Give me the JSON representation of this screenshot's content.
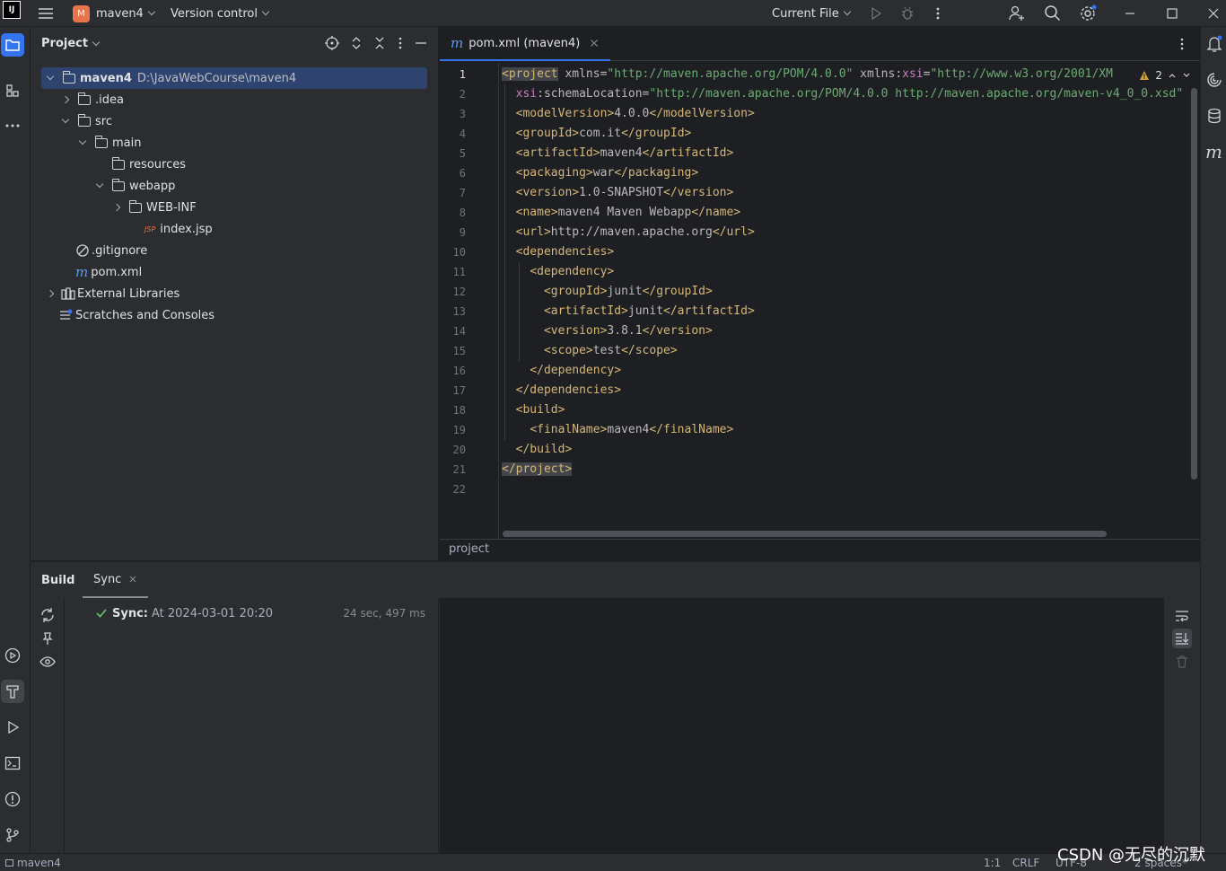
{
  "titlebar": {
    "logo": "IJ",
    "project_badge": "M",
    "project_name": "maven4",
    "vcs_label": "Version control",
    "run_config": "Current File"
  },
  "project_panel": {
    "title": "Project",
    "tree": [
      {
        "label": "maven4",
        "hint": "D:\\JavaWebCourse\\maven4",
        "icon": "module-folder-icon",
        "expanded": true,
        "selected": true
      },
      {
        "label": ".idea",
        "icon": "folder-icon",
        "expanded": false
      },
      {
        "label": "src",
        "icon": "folder-icon",
        "expanded": true
      },
      {
        "label": "main",
        "icon": "folder-icon",
        "expanded": true
      },
      {
        "label": "resources",
        "icon": "resources-folder-icon"
      },
      {
        "label": "webapp",
        "icon": "folder-icon",
        "expanded": true
      },
      {
        "label": "WEB-INF",
        "icon": "folder-icon",
        "expanded": false
      },
      {
        "label": "index.jsp",
        "icon": "jsp-file-icon",
        "badge": "JSP"
      },
      {
        "label": ".gitignore",
        "icon": "ignore-file-icon"
      },
      {
        "label": "pom.xml",
        "icon": "maven-file-icon",
        "badge": "m"
      },
      {
        "label": "External Libraries",
        "icon": "libraries-icon",
        "expanded": false
      },
      {
        "label": "Scratches and Consoles",
        "icon": "scratches-icon"
      }
    ]
  },
  "editor": {
    "tab_label": "pom.xml (maven4)",
    "tab_icon": "m",
    "warning_count": "2",
    "breadcrumb": "project",
    "lines": [
      [
        [
          "t",
          "<project"
        ],
        [
          "a",
          " xmlns="
        ],
        [
          "s",
          "\"http://maven.apache.org/POM/4.0.0\""
        ],
        [
          "a",
          " xmlns:"
        ],
        [
          "ns",
          "xsi"
        ],
        [
          "a",
          "="
        ],
        [
          "s",
          "\"http://www.w3.org/2001/XM"
        ]
      ],
      [
        [
          "a",
          "  "
        ],
        [
          "ns",
          "xsi"
        ],
        [
          "a",
          ":schemaLocation="
        ],
        [
          "s",
          "\"http://maven.apache.org/POM/4.0.0 http://maven.apache.org/maven-v4_0_0.xsd\""
        ]
      ],
      [
        [
          "a",
          "  "
        ],
        [
          "t",
          "<modelVersion>"
        ],
        [
          "a",
          "4.0.0"
        ],
        [
          "t",
          "</modelVersion>"
        ]
      ],
      [
        [
          "a",
          "  "
        ],
        [
          "t",
          "<groupId>"
        ],
        [
          "a",
          "com.it"
        ],
        [
          "t",
          "</groupId>"
        ]
      ],
      [
        [
          "a",
          "  "
        ],
        [
          "t",
          "<artifactId>"
        ],
        [
          "a",
          "maven4"
        ],
        [
          "t",
          "</artifactId>"
        ]
      ],
      [
        [
          "a",
          "  "
        ],
        [
          "t",
          "<packaging>"
        ],
        [
          "a",
          "war"
        ],
        [
          "t",
          "</packaging>"
        ]
      ],
      [
        [
          "a",
          "  "
        ],
        [
          "t",
          "<version>"
        ],
        [
          "a",
          "1.0-SNAPSHOT"
        ],
        [
          "t",
          "</version>"
        ]
      ],
      [
        [
          "a",
          "  "
        ],
        [
          "t",
          "<name>"
        ],
        [
          "a",
          "maven4 Maven Webapp"
        ],
        [
          "t",
          "</name>"
        ]
      ],
      [
        [
          "a",
          "  "
        ],
        [
          "t",
          "<url>"
        ],
        [
          "a",
          "http://maven.apache.org"
        ],
        [
          "t",
          "</url>"
        ]
      ],
      [
        [
          "a",
          "  "
        ],
        [
          "t",
          "<dependencies>"
        ]
      ],
      [
        [
          "a",
          "    "
        ],
        [
          "t",
          "<dependency>"
        ]
      ],
      [
        [
          "a",
          "      "
        ],
        [
          "t",
          "<groupId>"
        ],
        [
          "a",
          "junit"
        ],
        [
          "t",
          "</groupId>"
        ]
      ],
      [
        [
          "a",
          "      "
        ],
        [
          "t",
          "<artifactId>"
        ],
        [
          "a",
          "junit"
        ],
        [
          "t",
          "</artifactId>"
        ]
      ],
      [
        [
          "a",
          "      "
        ],
        [
          "t",
          "<version>"
        ],
        [
          "a",
          "3.8.1"
        ],
        [
          "t",
          "</version>"
        ]
      ],
      [
        [
          "a",
          "      "
        ],
        [
          "t",
          "<scope>"
        ],
        [
          "a",
          "test"
        ],
        [
          "t",
          "</scope>"
        ]
      ],
      [
        [
          "a",
          "    "
        ],
        [
          "t",
          "</dependency>"
        ]
      ],
      [
        [
          "a",
          "  "
        ],
        [
          "t",
          "</dependencies>"
        ]
      ],
      [
        [
          "a",
          "  "
        ],
        [
          "t",
          "<build>"
        ]
      ],
      [
        [
          "a",
          "    "
        ],
        [
          "t",
          "<finalName>"
        ],
        [
          "a",
          "maven4"
        ],
        [
          "t",
          "</finalName>"
        ]
      ],
      [
        [
          "a",
          "  "
        ],
        [
          "t",
          "</build>"
        ]
      ],
      [
        [
          "t",
          "</project>"
        ]
      ],
      []
    ],
    "line_numbers": [
      "1",
      "2",
      "3",
      "4",
      "5",
      "6",
      "7",
      "8",
      "9",
      "10",
      "11",
      "12",
      "13",
      "14",
      "15",
      "16",
      "17",
      "18",
      "19",
      "20",
      "21",
      "22"
    ]
  },
  "build_panel": {
    "tab_build": "Build",
    "tab_sync": "Sync",
    "sync_label": "Sync:",
    "sync_time": "At 2024-03-01 20:20",
    "sync_duration": "24 sec, 497 ms"
  },
  "statusbar": {
    "project": "maven4",
    "position": "1:1",
    "line_sep": "CRLF",
    "encoding": "UTF-8",
    "indent": "2 spaces*"
  },
  "watermark": "CSDN @无尽的沉默",
  "colors": {
    "accent": "#3574f0",
    "tag": "#d5b778",
    "string": "#6aab73",
    "namespace": "#c77dbb",
    "success": "#5fb865"
  }
}
